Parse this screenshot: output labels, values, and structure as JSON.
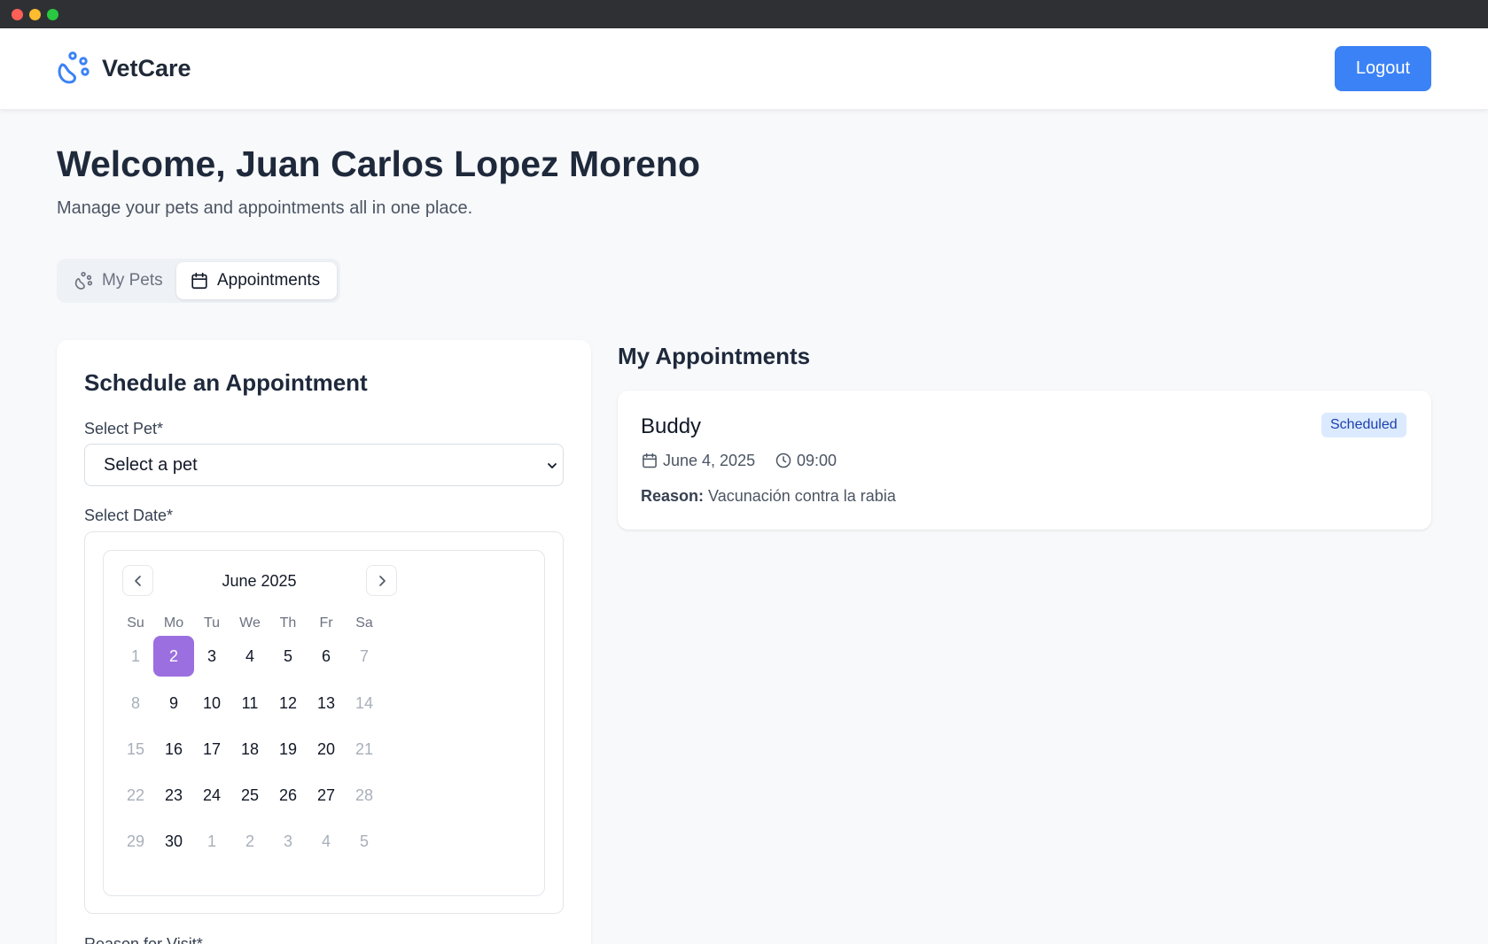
{
  "header": {
    "brand": "VetCare",
    "logout_label": "Logout"
  },
  "welcome": {
    "title": "Welcome, Juan Carlos Lopez Moreno",
    "subtitle": "Manage your pets and appointments all in one place."
  },
  "tabs": [
    {
      "label": "My Pets",
      "icon": "paw-icon",
      "active": false
    },
    {
      "label": "Appointments",
      "icon": "calendar-icon",
      "active": true
    }
  ],
  "schedule_form": {
    "title": "Schedule an Appointment",
    "pet_label": "Select Pet*",
    "pet_value": "Select a pet",
    "date_label": "Select Date*",
    "reason_label": "Reason for Visit*",
    "calendar": {
      "month": "June 2025",
      "weekdays": [
        "Su",
        "Mo",
        "Tu",
        "We",
        "Th",
        "Fr",
        "Sa"
      ],
      "weeks": [
        [
          "1",
          "2",
          "3",
          "4",
          "5",
          "6",
          "7"
        ],
        [
          "8",
          "9",
          "10",
          "11",
          "12",
          "13",
          "14"
        ],
        [
          "15",
          "16",
          "17",
          "18",
          "19",
          "20",
          "21"
        ],
        [
          "22",
          "23",
          "24",
          "25",
          "26",
          "27",
          "28"
        ],
        [
          "29",
          "30",
          "1",
          "2",
          "3",
          "4",
          "5"
        ]
      ],
      "selected_day": "2"
    }
  },
  "appointments": {
    "title": "My Appointments",
    "items": [
      {
        "pet": "Buddy",
        "status": "Scheduled",
        "date": "June 4, 2025",
        "time": "09:00",
        "reason_label": "Reason:",
        "reason": "Vacunación contra la rabia"
      }
    ]
  },
  "colors": {
    "primary": "#3b82f6",
    "selected_day": "#9b6fdf",
    "badge_bg": "#dbeafe",
    "badge_text": "#1e40af"
  }
}
